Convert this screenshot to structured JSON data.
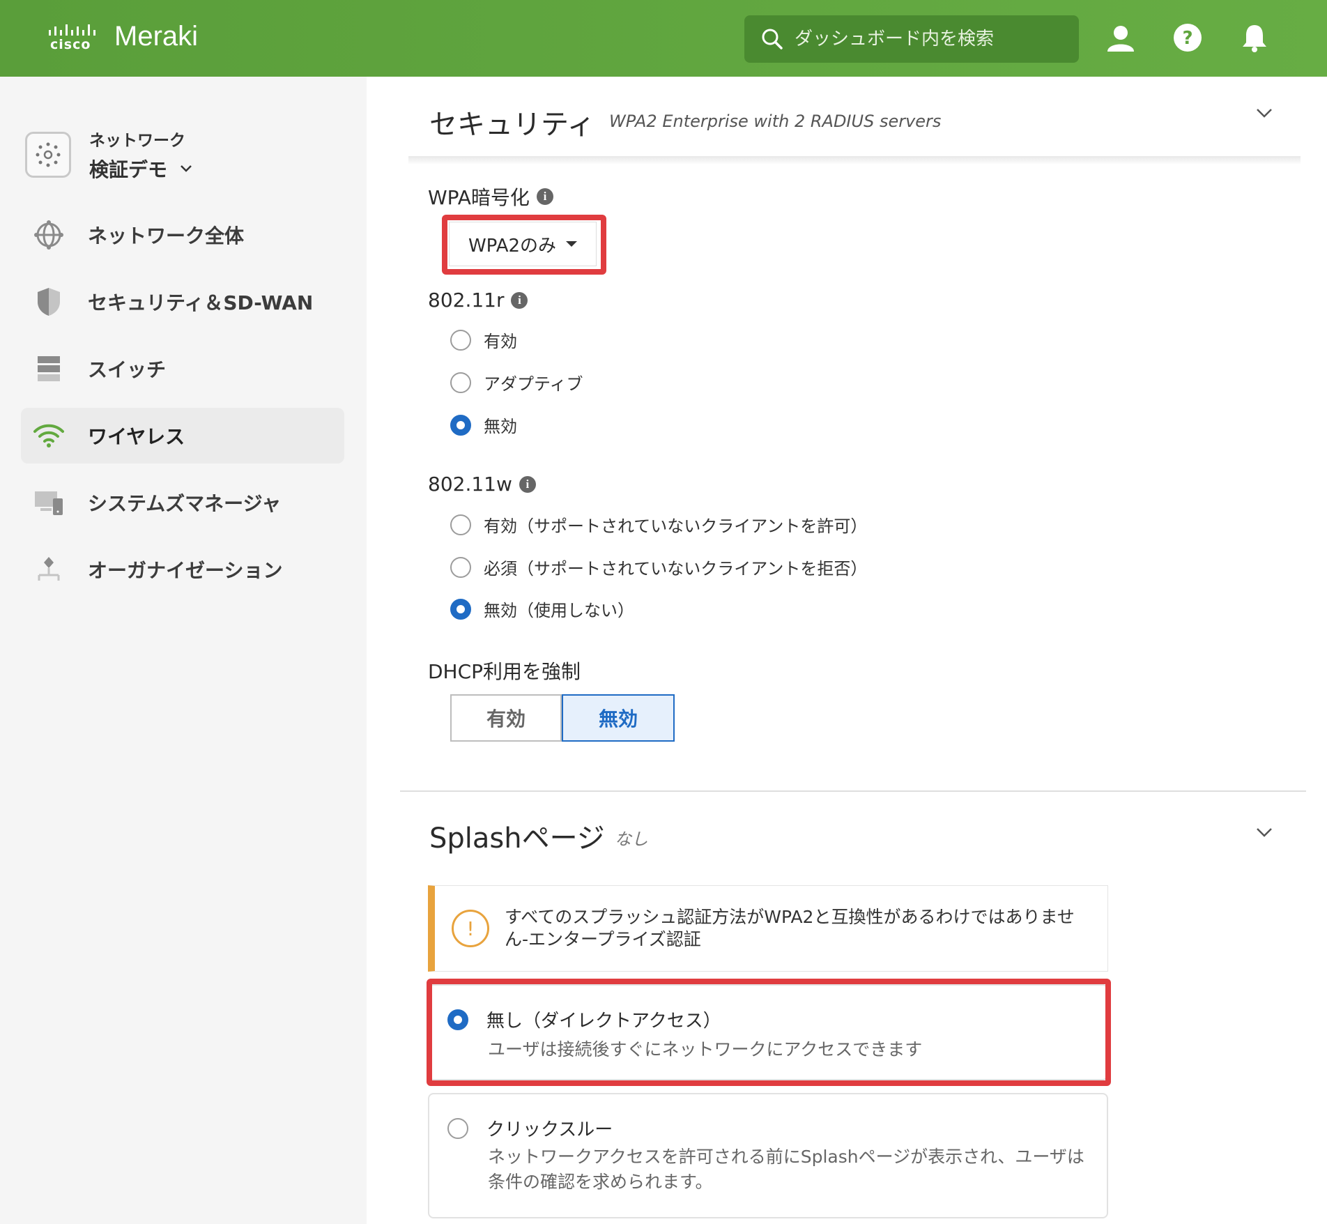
{
  "header": {
    "cisco_wordmark": "cisco",
    "brand": "Meraki",
    "search_placeholder": "ダッシュボード内を検索",
    "icons": [
      "search-icon",
      "user-icon",
      "help-icon",
      "bell-icon"
    ],
    "accent_color": "#5fa53d"
  },
  "sidebar": {
    "network_label": "ネットワーク",
    "network_name": "検証デモ",
    "items": [
      {
        "label": "ネットワーク全体",
        "icon": "globe-icon",
        "active": false
      },
      {
        "label": "セキュリティ＆SD-WAN",
        "icon": "shield-icon",
        "active": false
      },
      {
        "label": "スイッチ",
        "icon": "switch-icon",
        "active": false
      },
      {
        "label": "ワイヤレス",
        "icon": "wifi-icon",
        "active": true
      },
      {
        "label": "システムズマネージャ",
        "icon": "devices-icon",
        "active": false
      },
      {
        "label": "オーガナイゼーション",
        "icon": "organization-icon",
        "active": false
      }
    ]
  },
  "security": {
    "title": "セキュリティ",
    "subtitle": "WPA2 Enterprise with 2 RADIUS servers",
    "wpa_label": "WPA暗号化",
    "wpa_value": "WPA2のみ",
    "r_label": "802.11r",
    "r_options": [
      {
        "label": "有効",
        "checked": false
      },
      {
        "label": "アダプティブ",
        "checked": false
      },
      {
        "label": "無効",
        "checked": true
      }
    ],
    "w_label": "802.11w",
    "w_options": [
      {
        "label": "有効（サポートされていないクライアントを許可）",
        "checked": false
      },
      {
        "label": "必須（サポートされていないクライアントを拒否）",
        "checked": false
      },
      {
        "label": "無効（使用しない）",
        "checked": true
      }
    ],
    "dhcp_label": "DHCP利用を強制",
    "dhcp_on": "有効",
    "dhcp_off": "無効",
    "dhcp_selected": "無効"
  },
  "splash": {
    "title": "Splashページ",
    "subtitle": "なし",
    "warning": "すべてのスプラッシュ認証方法がWPA2と互換性があるわけではありません-エンタープライズ認証",
    "options": [
      {
        "title": "無し（ダイレクトアクセス）",
        "desc": "ユーザは接続後すぐにネットワークにアクセスできます",
        "checked": true
      },
      {
        "title": "クリックスルー",
        "desc": "ネットワークアクセスを許可される前にSplashページが表示され、ユーザは条件の確認を求められます。",
        "checked": false
      }
    ]
  },
  "colors": {
    "highlight": "#e03c3f",
    "radio_selected": "#1f6bc4",
    "warning": "#e8a33d"
  }
}
